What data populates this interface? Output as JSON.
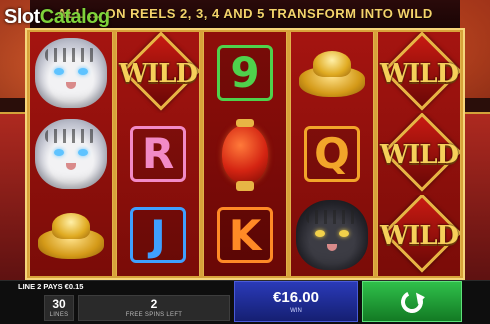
{
  "watermark": {
    "prefix": "Slot",
    "suffix": "Catalog"
  },
  "banner": {
    "text": "ALL … ON REELS 2, 3, 4 AND 5 TRANSFORM INTO WILD"
  },
  "reels": [
    [
      {
        "symbol": "white-tiger"
      },
      {
        "symbol": "white-tiger"
      },
      {
        "symbol": "gold-ingot"
      }
    ],
    [
      {
        "symbol": "wild",
        "label": "WILD"
      },
      {
        "symbol": "letter",
        "label": "R",
        "kind": "sym-r"
      },
      {
        "symbol": "letter",
        "label": "J",
        "kind": "sym-j"
      }
    ],
    [
      {
        "symbol": "letter",
        "label": "9",
        "kind": "sym-9"
      },
      {
        "symbol": "red-lantern"
      },
      {
        "symbol": "letter",
        "label": "K",
        "kind": "sym-k"
      }
    ],
    [
      {
        "symbol": "gold-ingot"
      },
      {
        "symbol": "letter",
        "label": "Q",
        "kind": "sym-q"
      },
      {
        "symbol": "black-tiger"
      }
    ],
    [
      {
        "symbol": "wild",
        "label": "WILD"
      },
      {
        "symbol": "wild",
        "label": "WILD"
      },
      {
        "symbol": "wild",
        "label": "WILD"
      }
    ]
  ],
  "status": {
    "line_pays": "LINE 2 PAYS €0.15",
    "lines_value": "30",
    "lines_label": "LINES",
    "free_spins_value": "2",
    "free_spins_label": "FREE SPINS LEFT",
    "win_value": "€16.00",
    "win_label": "WIN"
  },
  "colors": {
    "win_panel": "#1f2d9a",
    "spin_button": "#22a03a",
    "reel_bg": "#a51410",
    "frame_gold": "#d8a23a"
  }
}
